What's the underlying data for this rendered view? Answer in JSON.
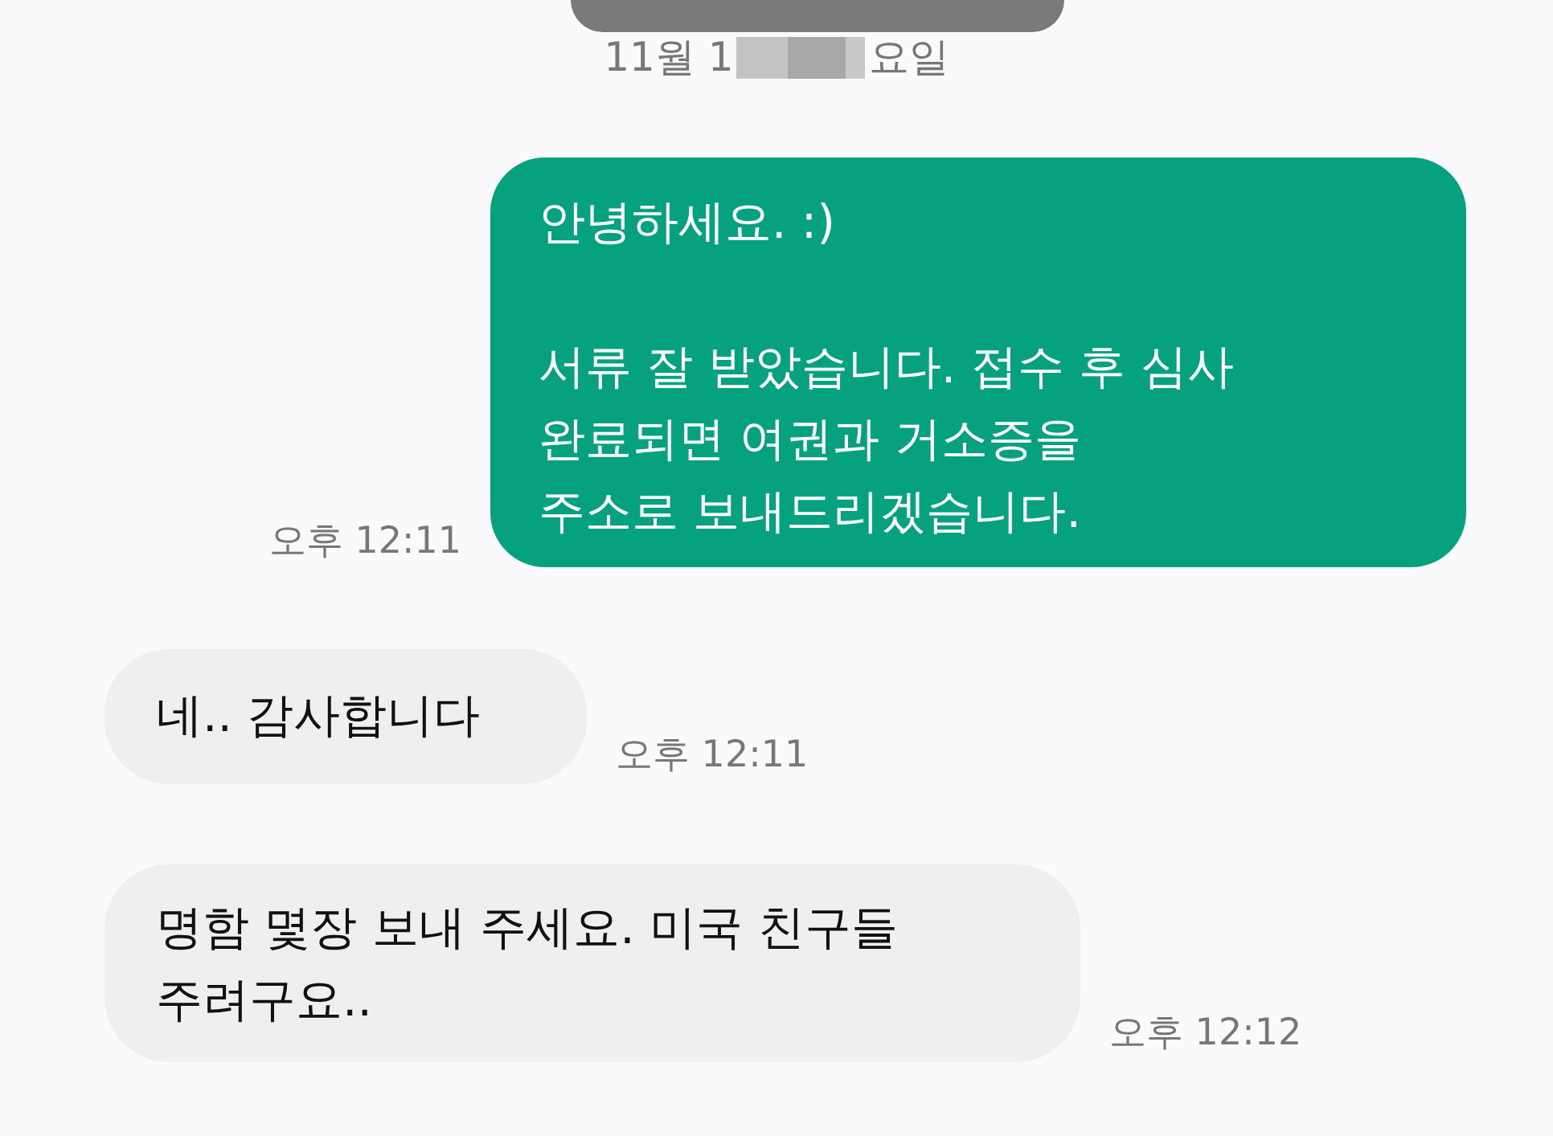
{
  "date_header": {
    "before": "11월 1",
    "after": "요일"
  },
  "messages": [
    {
      "kind": "sent",
      "text": "안녕하세요. :)\n\n서류 잘 받았습니다. 접수 후 심사\n완료되면 여권과 거소증을\n주소로 보내드리겠습니다.",
      "time": "오후 12:11"
    },
    {
      "kind": "received",
      "text": "네.. 감사합니다",
      "time": "오후 12:11"
    },
    {
      "kind": "received",
      "text": "명함 몇장 보내 주세요. 미국 친구들\n주려구요..",
      "time": "오후 12:12"
    }
  ]
}
